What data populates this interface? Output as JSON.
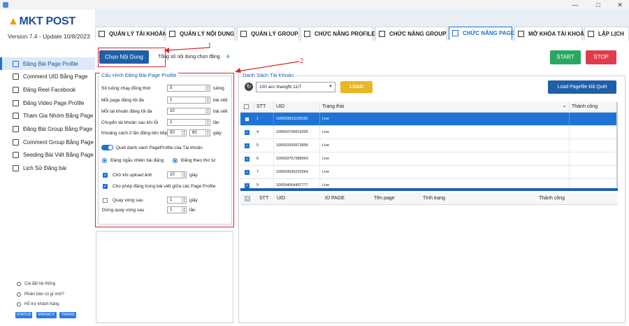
{
  "app": {
    "logo": "MKT POST",
    "version": "Version  7.4  -  Update  10/8/2023",
    "window_controls": [
      "—",
      "□",
      "✕"
    ]
  },
  "sidebar": {
    "items": [
      {
        "label": "Đăng Bài Page Profile",
        "icon": "document-icon",
        "active": true
      },
      {
        "label": "Comment UID Bằng Page",
        "icon": "comment-icon"
      },
      {
        "label": "Đăng Reel Facebook",
        "icon": "reel-icon"
      },
      {
        "label": "Đăng Video Page Profile",
        "icon": "video-icon"
      },
      {
        "label": "Tham Gia Nhóm Bằng Page",
        "icon": "group-join-icon"
      },
      {
        "label": "Đăng Bài Group Bằng Page",
        "icon": "group-post-icon"
      },
      {
        "label": "Comment Group Bằng Page",
        "icon": "comment-group-icon"
      },
      {
        "label": "Seeding Bài Viết Bằng Page",
        "icon": "seeding-icon"
      },
      {
        "label": "Lịch Sử Đăng bài",
        "icon": "hourglass-icon"
      }
    ],
    "footer": [
      {
        "label": "Cài đặt hệ thống",
        "icon": "gear-icon"
      },
      {
        "label": "Phiên bản có gì mới?",
        "icon": "info-icon"
      },
      {
        "label": "Hỗ trợ khách hàng",
        "icon": "help-icon"
      }
    ],
    "badges": [
      "STATUS",
      "PRIVACY",
      "TERMS"
    ]
  },
  "tabs": [
    {
      "label": "QUẢN LÝ TÀI KHOẢN",
      "icon": "account-icon"
    },
    {
      "label": "QUẢN LÝ NỘI DUNG",
      "icon": "content-icon"
    },
    {
      "label": "QUẢN LÝ GROUP",
      "icon": "group-icon"
    },
    {
      "label": "CHỨC NĂNG PROFILE",
      "icon": "profile-icon"
    },
    {
      "label": "CHỨC NĂNG GROUP",
      "icon": "group-func-icon"
    },
    {
      "label": "CHỨC NĂNG PAGE",
      "icon": "flag-icon",
      "active": true
    },
    {
      "label": "MỞ KHÓA TÀI KHOẢN",
      "icon": "at-icon"
    },
    {
      "label": "LẬP LỊCH",
      "icon": "calendar-icon"
    }
  ],
  "toolbar": {
    "choose_content": "Chọn Nội Dung",
    "count_label": "Tổng số nội dung chọn đăng",
    "count_value": "4",
    "start": "START",
    "stop": "STOP"
  },
  "annotations": {
    "one": "1",
    "two": "2"
  },
  "config": {
    "title": "Cấu Hình Đăng Bài Page Profile",
    "rows": [
      {
        "label": "Số luồng chạy đồng thời",
        "value": "5",
        "unit": "luồng"
      },
      {
        "label": "Mỗi page đăng tối đa",
        "value": "1",
        "unit": "bài viết"
      },
      {
        "label": "Mỗi tài khoản đăng tối đa",
        "value": "10",
        "unit": "bài viết"
      },
      {
        "label": "Chuyển tài khoản sau khi lỗi",
        "value": "2",
        "unit": "lần"
      },
      {
        "label": "Khoảng cách 2 lần đăng liên tiếp",
        "value": "50",
        "value2": "60",
        "unit": "giây"
      }
    ],
    "toggle_label": "Quét danh sách PageProfile của Tài khoản",
    "radio_random": "Đăng ngẫu nhiên bài đăng",
    "radio_order": "Đăng theo thứ tự",
    "wait_upload": {
      "label": "Chờ khi upload ảnh",
      "value": "10",
      "unit": "giây"
    },
    "allow_duplicate": "Cho phép đăng trùng bài viết giữa các Page Profile",
    "loop_after": {
      "label": "Quay vòng sau",
      "value": "1",
      "unit": "giây"
    },
    "stop_loop": {
      "label": "Dừng quay vòng sau",
      "value": "1",
      "unit": "lần"
    }
  },
  "accounts": {
    "title": "Danh Sách Tài Khoản",
    "combo_value": "100 acc thangfb 11/7",
    "load": "LOAD",
    "load_pagefile": "Load Pagefile Đã Quét",
    "columns": [
      "STT",
      "UID",
      "Trạng thái",
      "Thành công"
    ],
    "rows": [
      {
        "stt": "1",
        "uid": "100093831195535",
        "status": "Live"
      },
      {
        "stt": "4",
        "uid": "100093706819205",
        "status": "Live"
      },
      {
        "stt": "5",
        "uid": "100093930973895",
        "status": "Live"
      },
      {
        "stt": "6",
        "uid": "100093767388043",
        "status": "Live"
      },
      {
        "stt": "7",
        "uid": "100093636202564",
        "status": "Live"
      },
      {
        "stt": "9",
        "uid": "100094064497777",
        "status": "Live"
      }
    ],
    "page_columns": [
      "STT",
      "UID",
      "ID PAGE",
      "Tên page",
      "Tình trạng",
      "Thành công"
    ]
  }
}
